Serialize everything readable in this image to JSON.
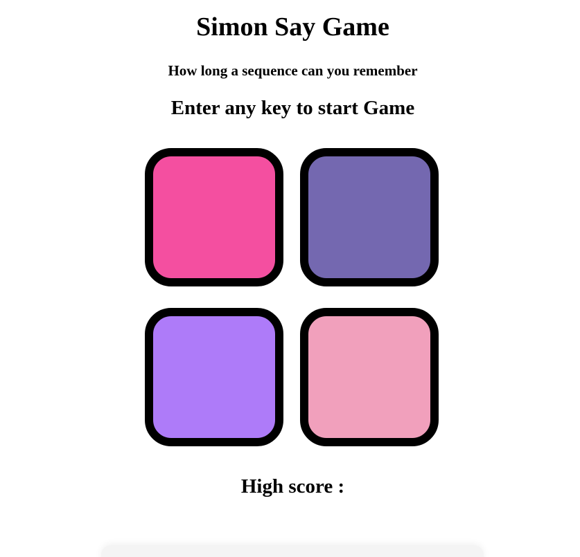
{
  "header": {
    "title": "Simon Say Game",
    "subtitle": "How long a sequence can you remember",
    "status": "Enter any key to start Game"
  },
  "buttons": [
    {
      "id": "btn-1",
      "color": "#f44fa0"
    },
    {
      "id": "btn-2",
      "color": "#7468b0"
    },
    {
      "id": "btn-3",
      "color": "#ae7bf9"
    },
    {
      "id": "btn-4",
      "color": "#f1a0bc"
    }
  ],
  "score": {
    "label": "High score :"
  }
}
